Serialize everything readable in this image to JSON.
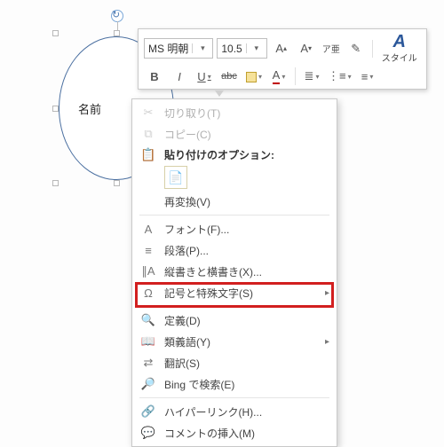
{
  "shape": {
    "label": "名前"
  },
  "toolbar": {
    "font_name": "MS 明朝",
    "font_size": "10.5",
    "grow_font": "A",
    "shrink_font": "A",
    "ruby": "ア亜",
    "format_painter": "✎",
    "styles_label": "スタイル",
    "bold": "B",
    "italic": "I",
    "underline": "U",
    "strike": "abc",
    "font_color_letter": "A",
    "highlight_letter": "A",
    "bullets": "≣",
    "numbers": "⋮≡",
    "indent": "≡"
  },
  "contextMenu": {
    "cut": "切り取り(T)",
    "copy": "コピー(C)",
    "paste_options_label": "貼り付けのオプション:",
    "reconvert": "再変換(V)",
    "font": "フォント(F)...",
    "paragraph": "段落(P)...",
    "text_direction": "縦書きと横書き(X)...",
    "symbols": "記号と特殊文字(S)",
    "define": "定義(D)",
    "thesaurus": "類義語(Y)",
    "translate": "翻訳(S)",
    "bing": "Bing で検索(E)",
    "hyperlink": "ハイパーリンク(H)...",
    "new_comment": "コメントの挿入(M)"
  }
}
